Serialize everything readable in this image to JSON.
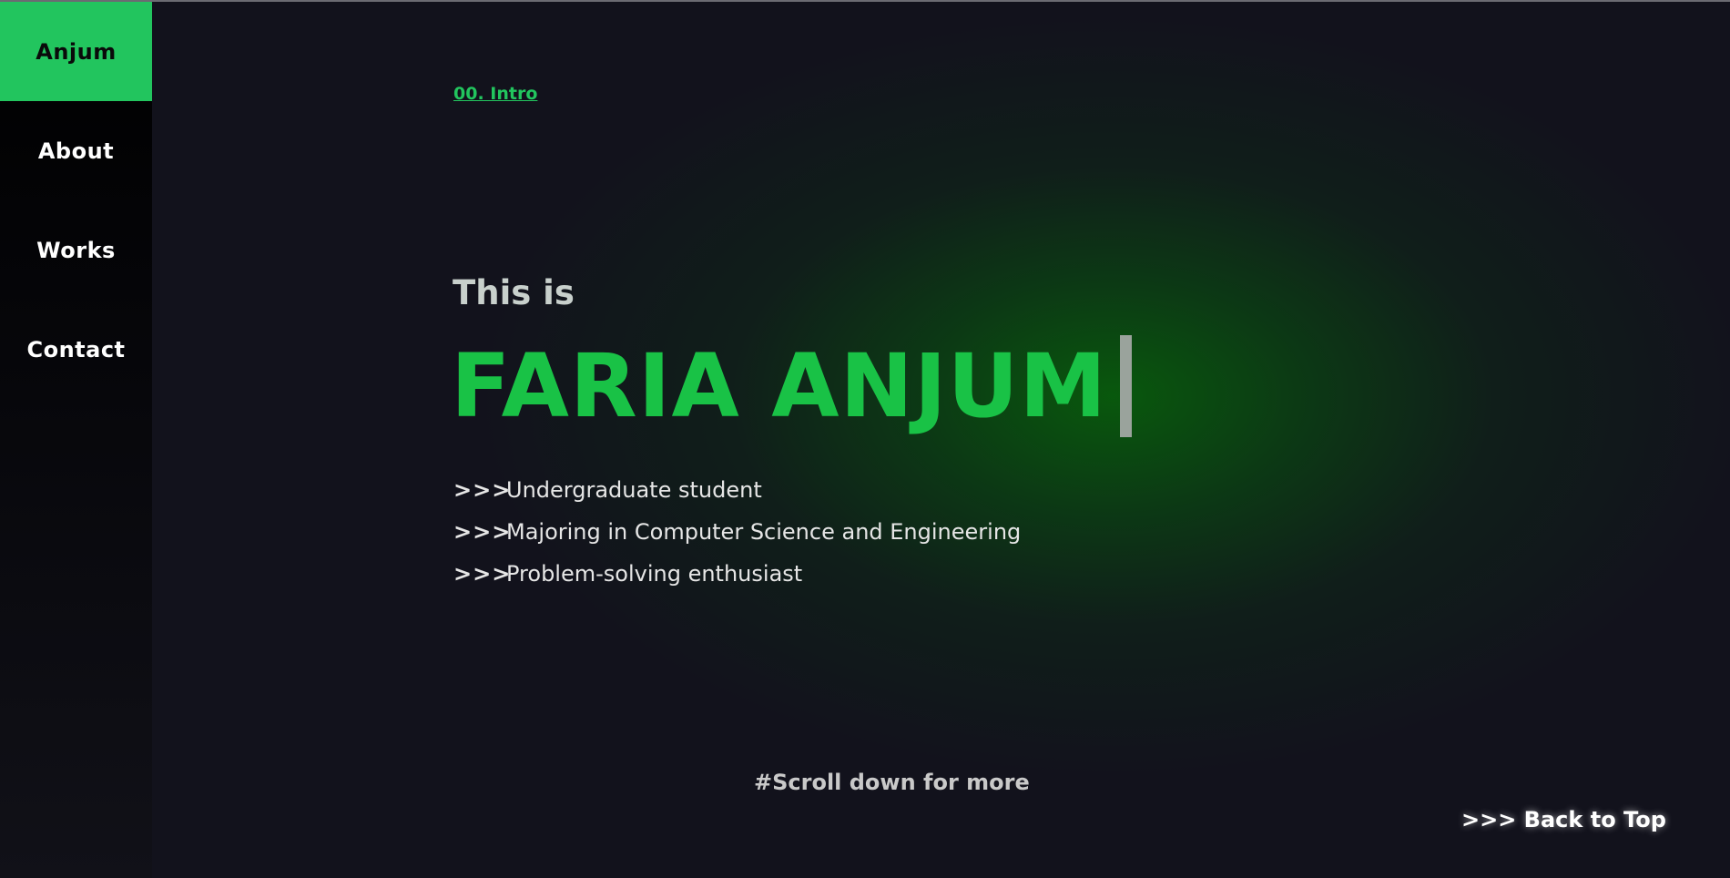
{
  "sidebar": {
    "items": [
      {
        "label": "Anjum"
      },
      {
        "label": "About"
      },
      {
        "label": "Works"
      },
      {
        "label": "Contact"
      }
    ]
  },
  "section": {
    "label": "00. Intro"
  },
  "hero": {
    "greeting": "This is",
    "name": "FARIA ANJUM",
    "bullet_marker": ">>>",
    "bullets": [
      "Undergraduate student",
      "Majoring in Computer Science and Engineering",
      "Problem-solving enthusiast"
    ]
  },
  "footer": {
    "scroll_hint": "#Scroll down for more",
    "back_to_top": ">>> Back to Top"
  },
  "colors": {
    "accent": "#22c55e",
    "background": "#12121c",
    "sidebar": "#000000"
  }
}
